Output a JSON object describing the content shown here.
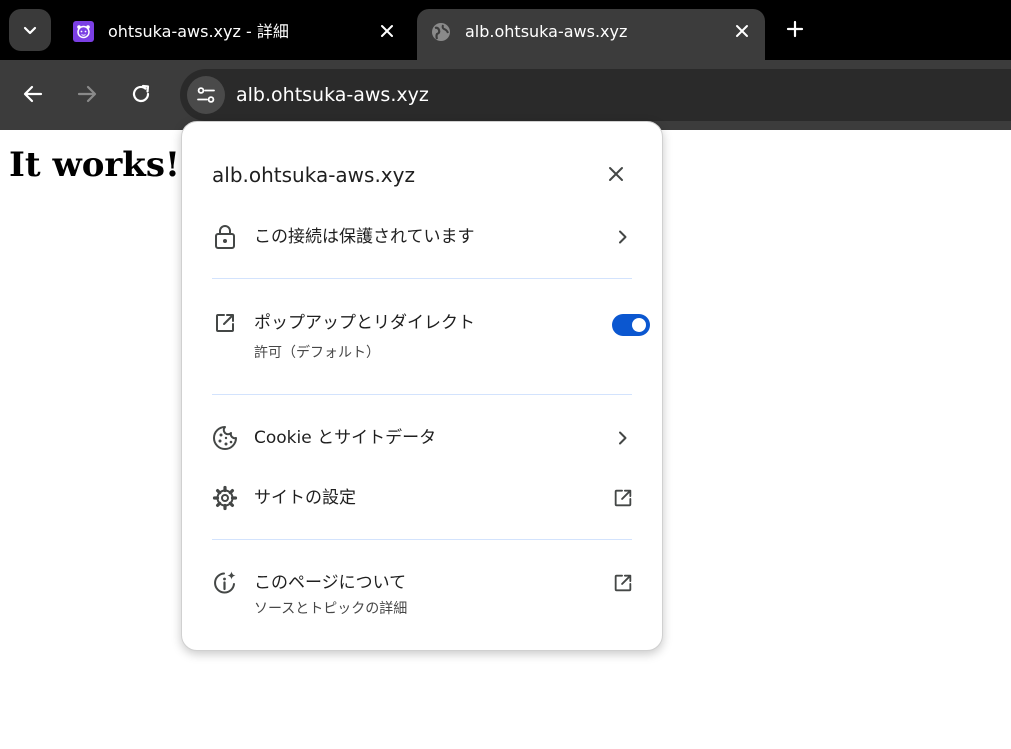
{
  "browser": {
    "tabs": [
      {
        "title": "ohtsuka-aws.xyz - 詳細",
        "favicon": "purple-otter-icon",
        "active": false
      },
      {
        "title": "alb.ohtsuka-aws.xyz",
        "favicon": "globe-icon",
        "active": true
      }
    ],
    "url": "alb.ohtsuka-aws.xyz"
  },
  "page": {
    "heading": "It works!"
  },
  "site_info": {
    "title": "alb.ohtsuka-aws.xyz",
    "connection_label": "この接続は保護されています",
    "popups_label": "ポップアップとリダイレクト",
    "popups_status": "許可（デフォルト）",
    "popups_enabled": true,
    "cookies_label": "Cookie とサイトデータ",
    "site_settings_label": "サイトの設定",
    "about_label": "このページについて",
    "about_sub": "ソースとトピックの詳細"
  },
  "colors": {
    "tabstrip_bg": "#000000",
    "toolbar_bg": "#3c3c3c",
    "toggle_on": "#0b57d0",
    "divider": "#d3e3fd",
    "favicon_purple": "#7b3fe4"
  }
}
